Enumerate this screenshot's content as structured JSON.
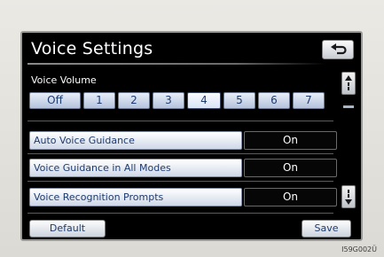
{
  "screen": {
    "title": "Voice Settings",
    "back_icon": "return-arrow-icon"
  },
  "volume": {
    "label": "Voice Volume",
    "options": [
      "Off",
      "1",
      "2",
      "3",
      "4",
      "5",
      "6",
      "7"
    ],
    "selected": "4"
  },
  "settings": [
    {
      "label": "Auto Voice Guidance",
      "value": "On"
    },
    {
      "label": "Voice Guidance in All Modes",
      "value": "On"
    },
    {
      "label": "Voice Recognition Prompts",
      "value": "On"
    }
  ],
  "scroll": {
    "up_icon": "scroll-up-icon",
    "down_icon": "scroll-down-icon"
  },
  "footer": {
    "default_label": "Default",
    "save_label": "Save"
  },
  "image_code": "I59G002Ü"
}
